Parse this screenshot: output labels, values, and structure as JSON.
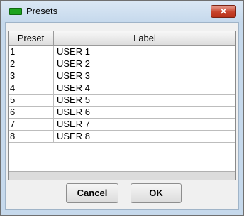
{
  "window": {
    "title": "Presets",
    "close_glyph": "✕",
    "icon": "green-rect-icon",
    "accent_close_color": "#c7432b",
    "icon_color": "#1ea31e"
  },
  "table": {
    "columns": [
      "Preset",
      "Label"
    ],
    "rows": [
      {
        "preset": "1",
        "label": "USER 1"
      },
      {
        "preset": "2",
        "label": "USER 2"
      },
      {
        "preset": "3",
        "label": "USER 3"
      },
      {
        "preset": "4",
        "label": "USER 4"
      },
      {
        "preset": "5",
        "label": "USER 5"
      },
      {
        "preset": "6",
        "label": "USER 6"
      },
      {
        "preset": "7",
        "label": "USER 7"
      },
      {
        "preset": "8",
        "label": "USER 8"
      }
    ]
  },
  "buttons": {
    "cancel": "Cancel",
    "ok": "OK"
  }
}
